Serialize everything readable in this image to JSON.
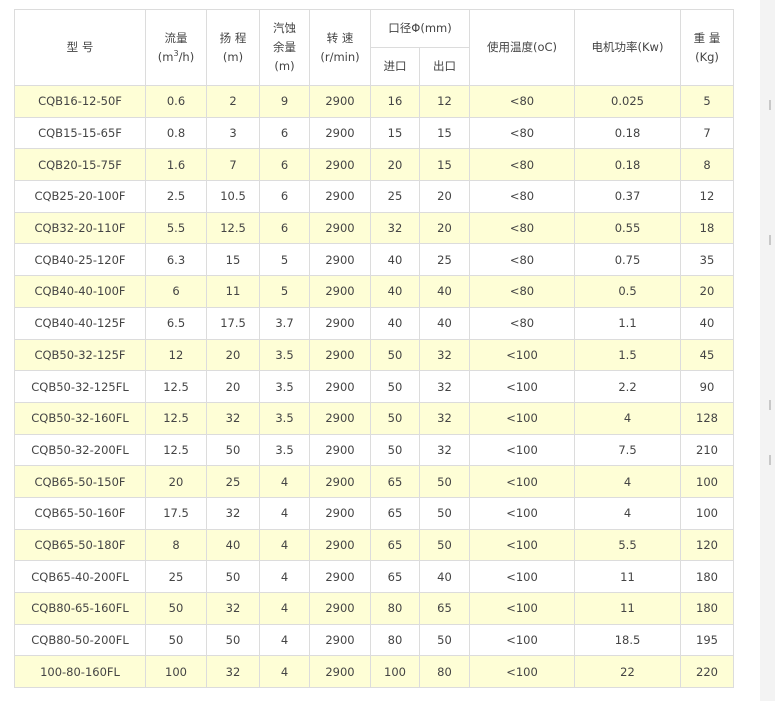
{
  "headers": {
    "model": "型 号",
    "flow_label": "流量",
    "flow_unit_prefix": "(m",
    "flow_unit_sup": "3",
    "flow_unit_suffix": "/h)",
    "head_label": "扬 程",
    "head_unit": "(m)",
    "npsh_line1": "汽蚀",
    "npsh_line2": "余量",
    "npsh_unit": "(m)",
    "speed_label": "转 速",
    "speed_unit": "(r/min)",
    "diameter": "口径Φ(mm)",
    "inlet": "进口",
    "outlet": "出口",
    "temp": "使用温度(oC)",
    "power": "电机功率(Kw)",
    "weight_label": "重 量",
    "weight_unit": "(Kg)"
  },
  "rows": [
    {
      "model": "CQB16-12-50F",
      "flow": "0.6",
      "head": "2",
      "npsh": "9",
      "speed": "2900",
      "inlet": "16",
      "outlet": "12",
      "temp": "<80",
      "power": "0.025",
      "weight": "5"
    },
    {
      "model": "CQB15-15-65F",
      "flow": "0.8",
      "head": "3",
      "npsh": "6",
      "speed": "2900",
      "inlet": "15",
      "outlet": "15",
      "temp": "<80",
      "power": "0.18",
      "weight": "7"
    },
    {
      "model": "CQB20-15-75F",
      "flow": "1.6",
      "head": "7",
      "npsh": "6",
      "speed": "2900",
      "inlet": "20",
      "outlet": "15",
      "temp": "<80",
      "power": "0.18",
      "weight": "8"
    },
    {
      "model": "CQB25-20-100F",
      "flow": "2.5",
      "head": "10.5",
      "npsh": "6",
      "speed": "2900",
      "inlet": "25",
      "outlet": "20",
      "temp": "<80",
      "power": "0.37",
      "weight": "12"
    },
    {
      "model": "CQB32-20-110F",
      "flow": "5.5",
      "head": "12.5",
      "npsh": "6",
      "speed": "2900",
      "inlet": "32",
      "outlet": "20",
      "temp": "<80",
      "power": "0.55",
      "weight": "18"
    },
    {
      "model": "CQB40-25-120F",
      "flow": "6.3",
      "head": "15",
      "npsh": "5",
      "speed": "2900",
      "inlet": "40",
      "outlet": "25",
      "temp": "<80",
      "power": "0.75",
      "weight": "35"
    },
    {
      "model": "CQB40-40-100F",
      "flow": "6",
      "head": "11",
      "npsh": "5",
      "speed": "2900",
      "inlet": "40",
      "outlet": "40",
      "temp": "<80",
      "power": "0.5",
      "weight": "20"
    },
    {
      "model": "CQB40-40-125F",
      "flow": "6.5",
      "head": "17.5",
      "npsh": "3.7",
      "speed": "2900",
      "inlet": "40",
      "outlet": "40",
      "temp": "<80",
      "power": "1.1",
      "weight": "40"
    },
    {
      "model": "CQB50-32-125F",
      "flow": "12",
      "head": "20",
      "npsh": "3.5",
      "speed": "2900",
      "inlet": "50",
      "outlet": "32",
      "temp": "<100",
      "power": "1.5",
      "weight": "45"
    },
    {
      "model": "CQB50-32-125FL",
      "flow": "12.5",
      "head": "20",
      "npsh": "3.5",
      "speed": "2900",
      "inlet": "50",
      "outlet": "32",
      "temp": "<100",
      "power": "2.2",
      "weight": "90"
    },
    {
      "model": "CQB50-32-160FL",
      "flow": "12.5",
      "head": "32",
      "npsh": "3.5",
      "speed": "2900",
      "inlet": "50",
      "outlet": "32",
      "temp": "<100",
      "power": "4",
      "weight": "128"
    },
    {
      "model": "CQB50-32-200FL",
      "flow": "12.5",
      "head": "50",
      "npsh": "3.5",
      "speed": "2900",
      "inlet": "50",
      "outlet": "32",
      "temp": "<100",
      "power": "7.5",
      "weight": "210"
    },
    {
      "model": "CQB65-50-150F",
      "flow": "20",
      "head": "25",
      "npsh": "4",
      "speed": "2900",
      "inlet": "65",
      "outlet": "50",
      "temp": "<100",
      "power": "4",
      "weight": "100"
    },
    {
      "model": "CQB65-50-160F",
      "flow": "17.5",
      "head": "32",
      "npsh": "4",
      "speed": "2900",
      "inlet": "65",
      "outlet": "50",
      "temp": "<100",
      "power": "4",
      "weight": "100"
    },
    {
      "model": "CQB65-50-180F",
      "flow": "8",
      "head": "40",
      "npsh": "4",
      "speed": "2900",
      "inlet": "65",
      "outlet": "50",
      "temp": "<100",
      "power": "5.5",
      "weight": "120"
    },
    {
      "model": "CQB65-40-200FL",
      "flow": "25",
      "head": "50",
      "npsh": "4",
      "speed": "2900",
      "inlet": "65",
      "outlet": "40",
      "temp": "<100",
      "power": "11",
      "weight": "180"
    },
    {
      "model": "CQB80-65-160FL",
      "flow": "50",
      "head": "32",
      "npsh": "4",
      "speed": "2900",
      "inlet": "80",
      "outlet": "65",
      "temp": "<100",
      "power": "11",
      "weight": "180"
    },
    {
      "model": "CQB80-50-200FL",
      "flow": "50",
      "head": "50",
      "npsh": "4",
      "speed": "2900",
      "inlet": "80",
      "outlet": "50",
      "temp": "<100",
      "power": "18.5",
      "weight": "195"
    },
    {
      "model": "100-80-160FL",
      "flow": "100",
      "head": "32",
      "npsh": "4",
      "speed": "2900",
      "inlet": "100",
      "outlet": "80",
      "temp": "<100",
      "power": "22",
      "weight": "220"
    }
  ],
  "colors": {
    "stripe": "#fefed6",
    "border": "#dcdcdc",
    "text": "#444444"
  }
}
